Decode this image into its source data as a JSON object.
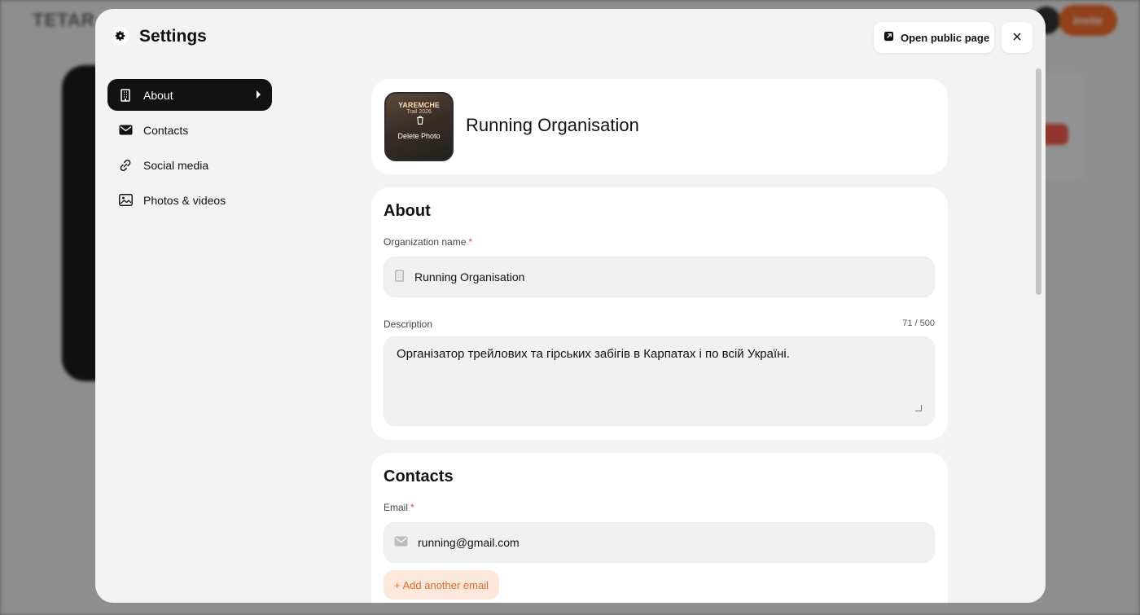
{
  "background": {
    "logo": "TETAR",
    "header_button": "Invite",
    "accent_color": "#f36b2b"
  },
  "modal": {
    "title": "Settings",
    "title_icon": "gear-icon",
    "open_public_label": "Open public page",
    "open_public_icon": "external-page-icon",
    "close_icon": "close-icon"
  },
  "nav": {
    "items": [
      {
        "label": "About",
        "icon": "building-icon",
        "active": true
      },
      {
        "label": "Contacts",
        "icon": "mail-icon",
        "active": false
      },
      {
        "label": "Social media",
        "icon": "link-icon",
        "active": false
      },
      {
        "label": "Photos & videos",
        "icon": "image-icon",
        "active": false
      }
    ]
  },
  "org": {
    "name": "Running Organisation",
    "photo_title": "YAREMCHE",
    "photo_subtitle": "Trail 2026",
    "delete_photo_label": "Delete Photo"
  },
  "about": {
    "heading": "About",
    "org_name_label": "Organization name",
    "org_name_required": "*",
    "org_name_value": "Running Organisation",
    "description_label": "Description",
    "description_counter": "71 / 500",
    "description_value": "Організатор трейлових та гірських забігів в Карпатах і по всій Україні."
  },
  "contacts": {
    "heading": "Contacts",
    "email_label": "Email",
    "email_required": "*",
    "email_value": "running@gmail.com",
    "add_email_label": "+ Add another email"
  }
}
